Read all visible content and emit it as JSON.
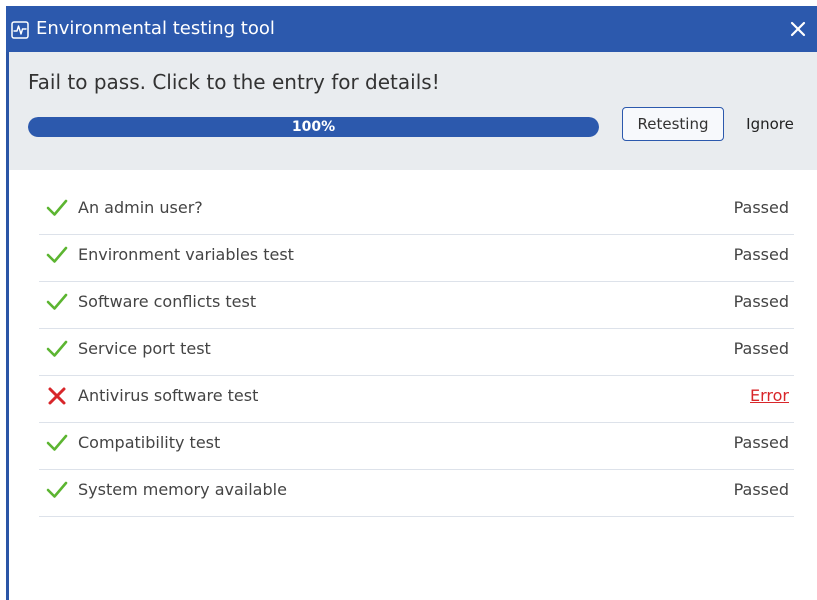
{
  "window": {
    "title": "Environmental testing tool",
    "title_icon": "pulse-monitor-icon",
    "close_icon": "close-icon"
  },
  "header": {
    "message": "Fail to pass. Click to the entry for details!",
    "progress": {
      "percent": 100,
      "label": "100%"
    },
    "retest_label": "Retesting",
    "ignore_label": "Ignore"
  },
  "tests": [
    {
      "label": "An admin user?",
      "result": "Passed",
      "state": "pass",
      "icon": "check-icon"
    },
    {
      "label": "Environment variables test",
      "result": "Passed",
      "state": "pass",
      "icon": "check-icon"
    },
    {
      "label": "Software conflicts test",
      "result": "Passed",
      "state": "pass",
      "icon": "check-icon"
    },
    {
      "label": "Service port test",
      "result": "Passed",
      "state": "pass",
      "icon": "check-icon"
    },
    {
      "label": "Antivirus software test",
      "result": "Error",
      "state": "error",
      "icon": "cross-icon"
    },
    {
      "label": "Compatibility test",
      "result": "Passed",
      "state": "pass",
      "icon": "check-icon"
    },
    {
      "label": "System memory available",
      "result": "Passed",
      "state": "pass",
      "icon": "check-icon"
    }
  ],
  "colors": {
    "accent": "#2c59ad",
    "pass": "#5cb531",
    "error": "#d8262a",
    "header_bg": "#e9ecef"
  }
}
